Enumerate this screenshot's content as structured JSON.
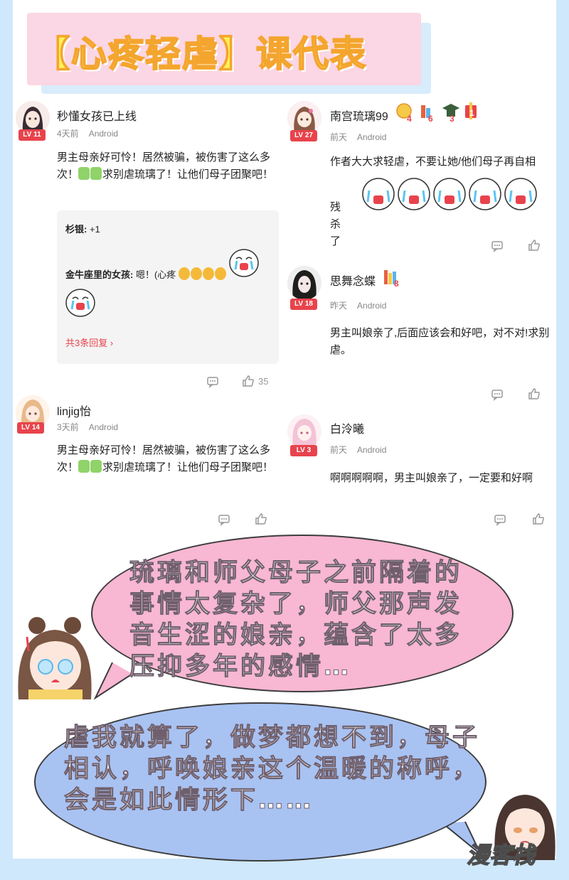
{
  "title": "【心疼轻虐】课代表",
  "comments_left": [
    {
      "username": "秒懂女孩已上线",
      "level": "LV 11",
      "time": "4天前",
      "platform": "Android",
      "text_part1": "男主母亲好可怜！居然被骗，被伤害了这么多次！",
      "text_part2": "求别虐琉璃了！让他们母子团聚吧！",
      "replies": [
        {
          "author": "杉银:",
          "text": " +1"
        },
        {
          "author": "金牛座里的女孩:",
          "text": " 嗯！(心疼"
        }
      ],
      "reply_more": "共3条回复 ›",
      "like_count": "35"
    },
    {
      "username": "linjig怡",
      "level": "LV 14",
      "time": "3天前",
      "platform": "Android",
      "text_part1": "男主母亲好可怜！居然被骗，被伤害了这么多次！",
      "text_part2": "求别虐琉璃了！让他们母子团聚吧！"
    }
  ],
  "comments_right": [
    {
      "username": "南宫琉璃99",
      "level": "LV 27",
      "time": "前天",
      "platform": "Android",
      "badges": [
        "4",
        "6",
        "3",
        "1"
      ],
      "text_part1": "作者大大求轻虐，不要让她/他们母子再自相",
      "text_part2": "残杀了"
    },
    {
      "username": "思舞念蝶",
      "level": "LV 18",
      "time": "昨天",
      "platform": "Android",
      "badges": [
        "8"
      ],
      "text": "男主叫娘亲了,后面应该会和好吧，对不对!求别虐。"
    },
    {
      "username": "白泠曦",
      "level": "LV 3",
      "time": "前天",
      "platform": "Android",
      "text": "啊啊啊啊啊，男主叫娘亲了，一定要和好啊"
    }
  ],
  "bubble_pink_text": "琉璃和师父母子之前隔着的事情太复杂了，师父那声发音生涩的娘亲，蕴含了太多压抑多年的感情…",
  "bubble_blue_text": "虐我就算了，做梦都想不到，母子相认，呼唤娘亲这个温暖的称呼，会是如此情形下……",
  "watermark": "漫客栈",
  "colors": {
    "level_badge": "#e8434c",
    "banner_pink": "#fbd6e4",
    "banner_text": "#fff25a",
    "bubble_pink": "#f8b7d2",
    "bubble_blue": "#a8c2f2",
    "frame_blue": "#cfe8fb"
  },
  "icons": [
    "comment-icon",
    "like-icon",
    "chevron-right-icon"
  ]
}
